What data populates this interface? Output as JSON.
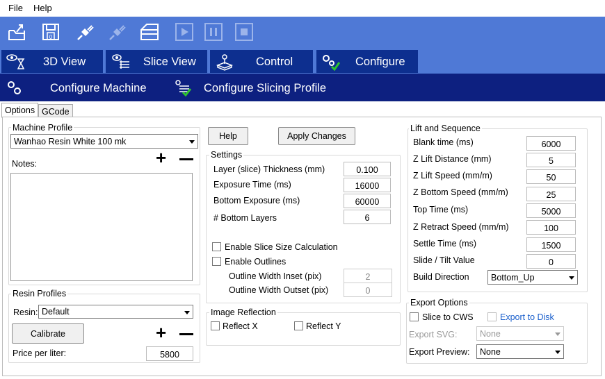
{
  "menu": {
    "file": "File",
    "help": "Help"
  },
  "tabs": {
    "view3d": "3D View",
    "slice": "Slice View",
    "control": "Control",
    "configure": "Configure"
  },
  "subtabs": {
    "machine": "Configure Machine",
    "slicing": "Configure Slicing Profile"
  },
  "inner_tabs": {
    "options": "Options",
    "gcode": "GCode"
  },
  "machine_profile": {
    "title": "Machine Profile",
    "selected": "Wanhao Resin White 100 mk",
    "notes_label": "Notes:"
  },
  "resin_profiles": {
    "title": "Resin Profiles",
    "resin_label": "Resin:",
    "resin_selected": "Default",
    "calibrate": "Calibrate",
    "price_label": "Price per liter:",
    "price": "5800"
  },
  "buttons": {
    "help": "Help",
    "apply": "Apply Changes"
  },
  "settings": {
    "title": "Settings",
    "layer_label": "Layer (slice) Thickness (mm)",
    "layer": "0.100",
    "exposure_label": "Exposure Time (ms)",
    "exposure": "16000",
    "bottom_exp_label": "Bottom Exposure (ms)",
    "bottom_exp": "60000",
    "bottom_layers_label": "# Bottom Layers",
    "bottom_layers": "6",
    "enable_slice_size": "Enable Slice Size Calculation",
    "enable_outlines": "Enable Outlines",
    "inset_label": "Outline Width Inset (pix)",
    "inset": "2",
    "outset_label": "Outline Width Outset (pix)",
    "outset": "0"
  },
  "reflection": {
    "title": "Image Reflection",
    "x": "Reflect X",
    "y": "Reflect Y"
  },
  "lift": {
    "title": "Lift and Sequence",
    "blank_label": "Blank time (ms)",
    "blank": "6000",
    "zlift_label": "Z Lift Distance (mm)",
    "zlift": "5",
    "zspeed_label": "Z Lift Speed (mm/m)",
    "zspeed": "50",
    "zbottom_label": "Z Bottom Speed (mm/m)",
    "zbottom": "25",
    "top_label": "Top Time (ms)",
    "top": "5000",
    "retract_label": "Z Retract Speed (mm/m)",
    "retract": "100",
    "settle_label": "Settle Time (ms)",
    "settle": "1500",
    "tilt_label": "Slide / Tilt Value",
    "tilt": "0",
    "build_label": "Build Direction",
    "build": "Bottom_Up"
  },
  "export": {
    "title": "Export Options",
    "slice_cws": "Slice to CWS",
    "export_disk": "Export to Disk",
    "svg_label": "Export SVG:",
    "svg": "None",
    "preview_label": "Export Preview:",
    "preview": "None"
  },
  "colors": {
    "toolbar": "#4f79d6",
    "tab": "#0d2f8f",
    "subbar": "#0d2080",
    "link": "#1a5fcc"
  }
}
